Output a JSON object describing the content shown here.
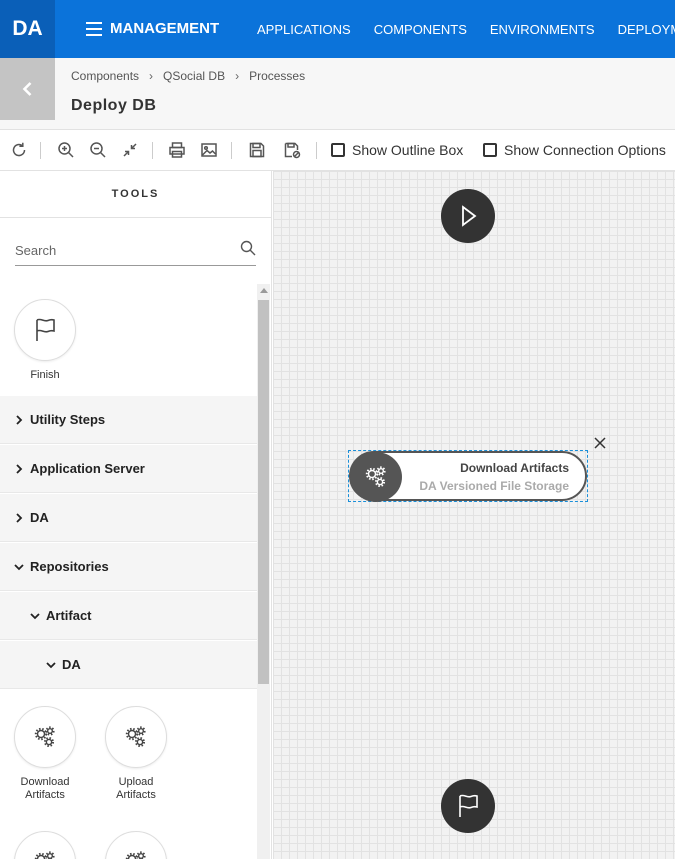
{
  "app": {
    "logo": "DA",
    "section": "MANAGEMENT"
  },
  "nav": {
    "items": [
      "APPLICATIONS",
      "COMPONENTS",
      "ENVIRONMENTS",
      "DEPLOYMENTS"
    ]
  },
  "breadcrumb": {
    "items": [
      "Components",
      "QSocial DB",
      "Processes"
    ]
  },
  "page": {
    "title": "Deploy DB"
  },
  "toolbar": {
    "icons": [
      "refresh-icon",
      "zoom-in-icon",
      "zoom-out-icon",
      "fit-icon",
      "print-icon",
      "image-icon",
      "save-icon",
      "save-cancel-icon"
    ],
    "show_outline_label": "Show Outline Box",
    "show_connection_label": "Show Connection Options"
  },
  "tools": {
    "title": "TOOLS",
    "search_placeholder": "Search",
    "finish_label": "Finish",
    "categories": [
      {
        "label": "Utility Steps",
        "expanded": false
      },
      {
        "label": "Application Server",
        "expanded": false
      },
      {
        "label": "DA",
        "expanded": false
      },
      {
        "label": "Repositories",
        "expanded": true
      },
      {
        "label": "Artifact",
        "expanded": true
      },
      {
        "label": "DA",
        "expanded": true
      }
    ],
    "items": [
      {
        "label": "Download Artifacts"
      },
      {
        "label": "Upload Artifacts"
      }
    ]
  },
  "canvas": {
    "step": {
      "name": "Download Artifacts",
      "subtitle": "DA Versioned File Storage"
    }
  },
  "colors": {
    "nav_bg": "#0b73da",
    "logo_bg": "#0a5fb8",
    "selection": "#1a8fd9"
  }
}
